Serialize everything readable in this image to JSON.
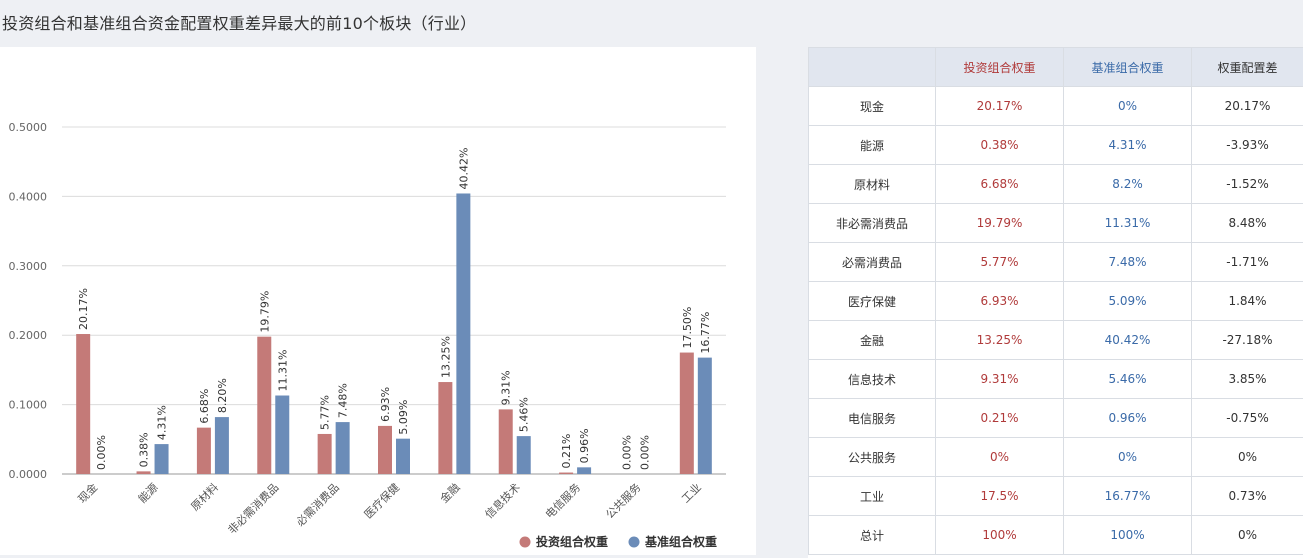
{
  "title": "投资组合和基准组合资金配置权重差异最大的前10个板块（行业）",
  "colors": {
    "portfolio": "#c47a78",
    "benchmark": "#6b8cb8",
    "portfolio_text": "#b03a3a",
    "benchmark_text": "#3a6aa8"
  },
  "chart_data": {
    "type": "bar",
    "categories": [
      "现金",
      "能源",
      "原材料",
      "非必需消费品",
      "必需消费品",
      "医疗保健",
      "金融",
      "信息技术",
      "电信服务",
      "公共服务",
      "工业"
    ],
    "series": [
      {
        "name": "投资组合权重",
        "values": [
          0.2017,
          0.0038,
          0.0668,
          0.1979,
          0.0577,
          0.0693,
          0.1325,
          0.0931,
          0.0021,
          0.0,
          0.175
        ],
        "labels": [
          "20.17%",
          "0.38%",
          "6.68%",
          "19.79%",
          "5.77%",
          "6.93%",
          "13.25%",
          "9.31%",
          "0.21%",
          "0.00%",
          "17.50%"
        ]
      },
      {
        "name": "基准组合权重",
        "values": [
          0.0,
          0.0431,
          0.082,
          0.1131,
          0.0748,
          0.0509,
          0.4042,
          0.0546,
          0.0096,
          0.0,
          0.1677
        ],
        "labels": [
          "0.00%",
          "4.31%",
          "8.20%",
          "11.31%",
          "7.48%",
          "5.09%",
          "40.42%",
          "5.46%",
          "0.96%",
          "0.00%",
          "16.77%"
        ]
      }
    ],
    "yticks": [
      "0.0000",
      "0.1000",
      "0.2000",
      "0.3000",
      "0.4000",
      "0.5000"
    ],
    "ylim": [
      0,
      0.5
    ],
    "grid": true,
    "legend_position": "bottom-right"
  },
  "table": {
    "headers": [
      "",
      "投资组合权重",
      "基准组合权重",
      "权重配置差"
    ],
    "rows": [
      [
        "现金",
        "20.17%",
        "0%",
        "20.17%"
      ],
      [
        "能源",
        "0.38%",
        "4.31%",
        "-3.93%"
      ],
      [
        "原材料",
        "6.68%",
        "8.2%",
        "-1.52%"
      ],
      [
        "非必需消费品",
        "19.79%",
        "11.31%",
        "8.48%"
      ],
      [
        "必需消费品",
        "5.77%",
        "7.48%",
        "-1.71%"
      ],
      [
        "医疗保健",
        "6.93%",
        "5.09%",
        "1.84%"
      ],
      [
        "金融",
        "13.25%",
        "40.42%",
        "-27.18%"
      ],
      [
        "信息技术",
        "9.31%",
        "5.46%",
        "3.85%"
      ],
      [
        "电信服务",
        "0.21%",
        "0.96%",
        "-0.75%"
      ],
      [
        "公共服务",
        "0%",
        "0%",
        "0%"
      ],
      [
        "工业",
        "17.5%",
        "16.77%",
        "0.73%"
      ],
      [
        "总计",
        "100%",
        "100%",
        "0%"
      ]
    ]
  }
}
